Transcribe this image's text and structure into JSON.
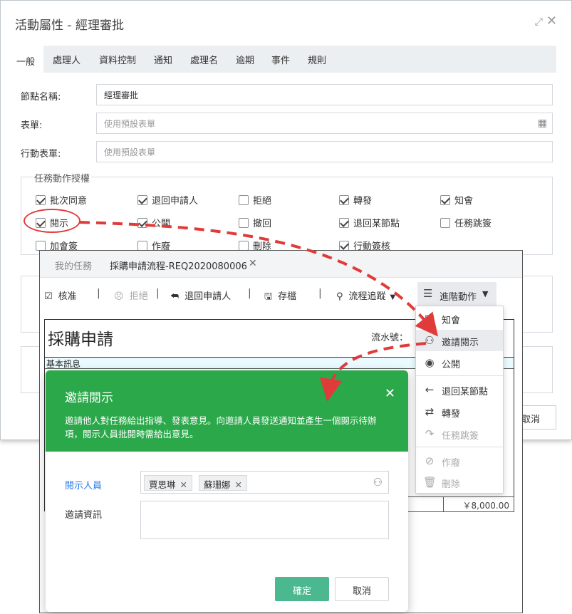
{
  "colors": {
    "accent_green": "#2ba84a",
    "confirm_green": "#4cb890",
    "annotation_red": "#e03b3b",
    "link_blue": "#2c7be5"
  },
  "dialog": {
    "title": "活動屬性 - 經理審批",
    "tabs": [
      "一般",
      "處理人",
      "資料控制",
      "通知",
      "處理名",
      "逾期",
      "事件",
      "規則"
    ],
    "active_tab": "一般",
    "fields": {
      "node_name": {
        "label": "節點名稱:",
        "value": "經理審批"
      },
      "form": {
        "label": "表單:",
        "placeholder": "使用預設表單"
      },
      "action_form": {
        "label": "行動表單:",
        "placeholder": "使用預設表單"
      }
    },
    "permissions": {
      "legend": "任務動作授權",
      "items": [
        {
          "label": "批次同意",
          "checked": true
        },
        {
          "label": "退回申請人",
          "checked": true
        },
        {
          "label": "拒絕",
          "checked": false
        },
        {
          "label": "轉發",
          "checked": true
        },
        {
          "label": "知會",
          "checked": true
        },
        {
          "label": "閱示",
          "checked": true
        },
        {
          "label": "公開",
          "checked": true
        },
        {
          "label": "撤回",
          "checked": false
        },
        {
          "label": "退回某節點",
          "checked": true
        },
        {
          "label": "任務跳簽",
          "checked": false
        },
        {
          "label": "加會簽",
          "checked": false
        },
        {
          "label": "作廢",
          "checked": false
        },
        {
          "label": "刪除",
          "checked": false
        },
        {
          "label": "行動簽核",
          "checked": true
        }
      ]
    },
    "cancel_label": "取消"
  },
  "task_window": {
    "tabs": [
      "我的任務",
      "採購申請流程-REQ2020080006"
    ],
    "toolbar": {
      "approve": "核准",
      "reject": "拒絕",
      "return_applicant": "退回申請人",
      "save": "存檔",
      "flow_trace": "流程追蹤",
      "advanced": "進階動作"
    },
    "document": {
      "title": "採購申請",
      "serial_label": "流水號：",
      "basic_info": "基本訊息",
      "amount": "￥8,000.00"
    },
    "advanced_menu": [
      {
        "label": "知會",
        "icon": "notify-icon",
        "disabled": false
      },
      {
        "label": "邀請閱示",
        "icon": "invite-user-icon",
        "disabled": false,
        "hover": true
      },
      {
        "label": "公開",
        "icon": "eye-icon",
        "disabled": false
      },
      {
        "label": "退回某節點",
        "icon": "arrow-left-icon",
        "disabled": false
      },
      {
        "label": "轉發",
        "icon": "transfer-icon",
        "disabled": false
      },
      {
        "label": "任務跳簽",
        "icon": "skip-icon",
        "disabled": true
      },
      {
        "label": "作廢",
        "icon": "void-icon",
        "disabled": true
      },
      {
        "label": "刪除",
        "icon": "trash-icon",
        "disabled": true
      }
    ]
  },
  "modal": {
    "title": "邀請閱示",
    "description": "邀請他人對任務給出指導、發表意見。向邀請人員發送通知並產生一個閱示待辦項，閱示人員批閱時需給出意見。",
    "reviewer_label": "閱示人員",
    "reviewers": [
      "賈思琳",
      "蘇珊娜"
    ],
    "invite_label": "邀請資訊",
    "invite_value": "",
    "confirm": "確定",
    "cancel": "取消"
  }
}
